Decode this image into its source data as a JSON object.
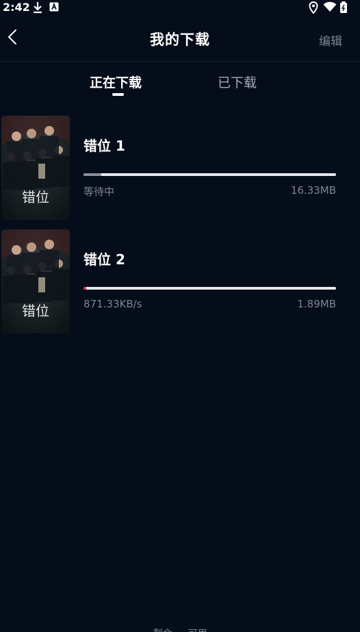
{
  "status_bar": {
    "time": "2:42",
    "icons": [
      "download-icon",
      "text-a-icon",
      "location-pin-icon",
      "wifi-icon",
      "battery-icon"
    ]
  },
  "header": {
    "title": "我的下载",
    "edit_label": "编辑",
    "back_icon": "chevron-left-icon"
  },
  "tabs": [
    {
      "label": "正在下载",
      "active": true
    },
    {
      "label": "已下载",
      "active": false
    }
  ],
  "downloads": [
    {
      "title": "错位 1",
      "status": "等待中",
      "size": "16.33MB",
      "progress": 0.07,
      "poster_text": "错位"
    },
    {
      "title": "错位 2",
      "status": "871.33KB/s",
      "size": "1.89MB",
      "progress": 0.01,
      "poster_text": "错位"
    }
  ],
  "footer": {
    "storage_text": "剩余  …  可用"
  },
  "colors": {
    "background": "#050d1a",
    "title": "#ffffff",
    "secondary_text": "#7d8592",
    "progress_track": "#e7e7e7",
    "progress_waiting": "#8a8f98",
    "progress_active": "#e8303a"
  }
}
